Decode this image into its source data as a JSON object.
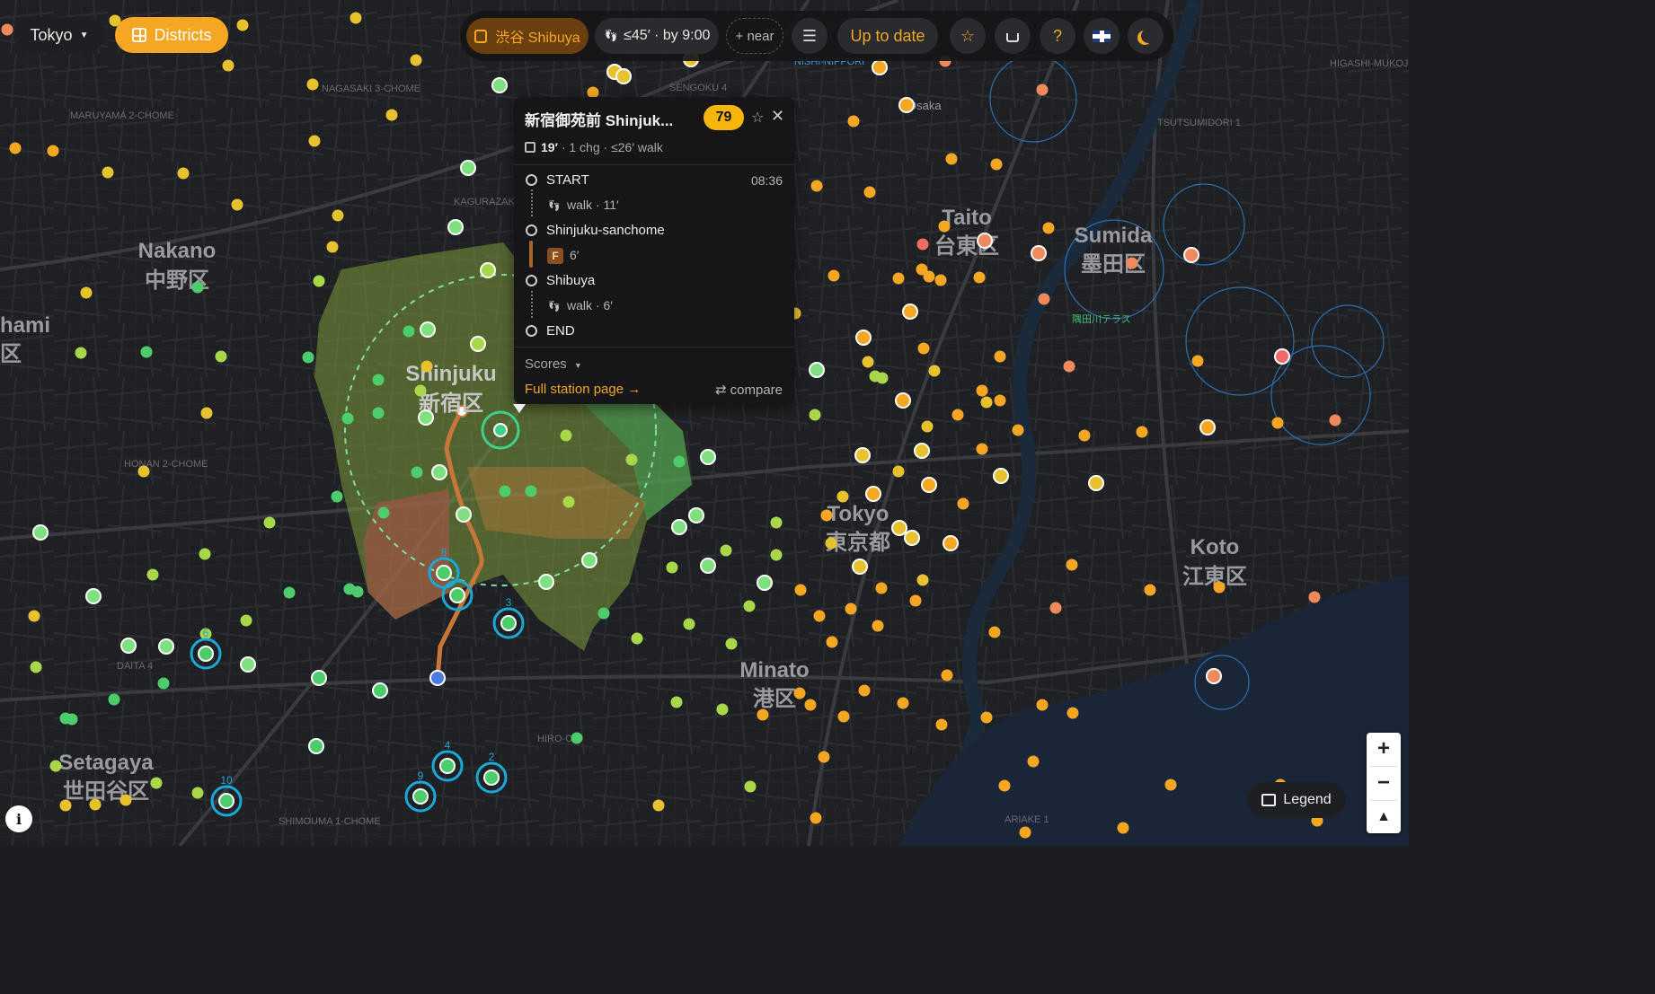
{
  "city_selector": {
    "label": "Tokyo",
    "icon": "caret-down-icon"
  },
  "districts_button": {
    "label": "Districts",
    "icon": "grid-icon"
  },
  "toolbar": {
    "origin_chip": {
      "label": "渋谷 Shibuya",
      "icon": "train-icon"
    },
    "commute_chip": {
      "label": "≤45′ · by 9:00",
      "icon": "walk-icon"
    },
    "near_chip": {
      "label": "+ near"
    },
    "filters_icon": "sliders-icon",
    "status": "Up to date",
    "favorites_icon": "star-icon",
    "basket_icon": "basket-icon",
    "help_label": "?",
    "language_icon": "uk-flag-icon",
    "theme_icon": "moon-icon"
  },
  "popup": {
    "title": "新宿御苑前 Shinjuk...",
    "score": "79",
    "summary_time": "19′",
    "summary_rest": "· 1 chg · ≤26′ walk",
    "steps": [
      {
        "label": "START",
        "time": "08:36"
      },
      {
        "leg": "walk · 11′"
      },
      {
        "label": "Shinjuku-sanchome"
      },
      {
        "line": "F",
        "leg": "6′"
      },
      {
        "label": "Shibuya"
      },
      {
        "leg": "walk · 6′"
      },
      {
        "label": "END"
      }
    ],
    "scores_label": "Scores",
    "full_page_link": "Full station page →",
    "compare_label": "compare"
  },
  "map_labels": [
    {
      "en": "Nakano",
      "jp": "中野区"
    },
    {
      "en": "Shinjuku",
      "jp": "新宿区"
    },
    {
      "en": "Taito",
      "jp": "台東区"
    },
    {
      "en": "Sumida",
      "jp": "墨田区"
    },
    {
      "en": "Tokyo",
      "jp": "東京都"
    },
    {
      "en": "Koto",
      "jp": "江東区"
    },
    {
      "en": "Minato",
      "jp": "港区"
    },
    {
      "en": "Setagaya",
      "jp": "世田谷区"
    },
    {
      "en": "hami",
      "jp": "区"
    }
  ],
  "small_labels": [
    "Osaka",
    "隅田川テラス",
    "SENGOKU 4",
    "KAGURAZAKA",
    "TSUTSUMIDORI 1",
    "NAGASAKI 3-CHOME",
    "MARUYAMA 2-CHOME",
    "HONAN 2-CHOME",
    "DAITA 4",
    "HIRO-O",
    "ARIAKE 1",
    "SHIMOUMA 1-CHOME",
    "NISHI-NIPPORI",
    "HIGASHI-MUKOJIMA"
  ],
  "numbered_stations": [
    "2",
    "3",
    "4",
    "6",
    "7",
    "8",
    "9",
    "10"
  ],
  "legend_button": {
    "label": "Legend",
    "icon": "map-icon"
  },
  "zoom": {
    "in": "+",
    "out": "−",
    "compass_icon": "compass-icon"
  },
  "info_button": {
    "label": "i"
  },
  "colors": {
    "accent": "#f5a623",
    "green": "#4ccc6a",
    "route": "#c8773a",
    "district_fill": "#7a9a3a",
    "ring": "#1aa8d8"
  }
}
